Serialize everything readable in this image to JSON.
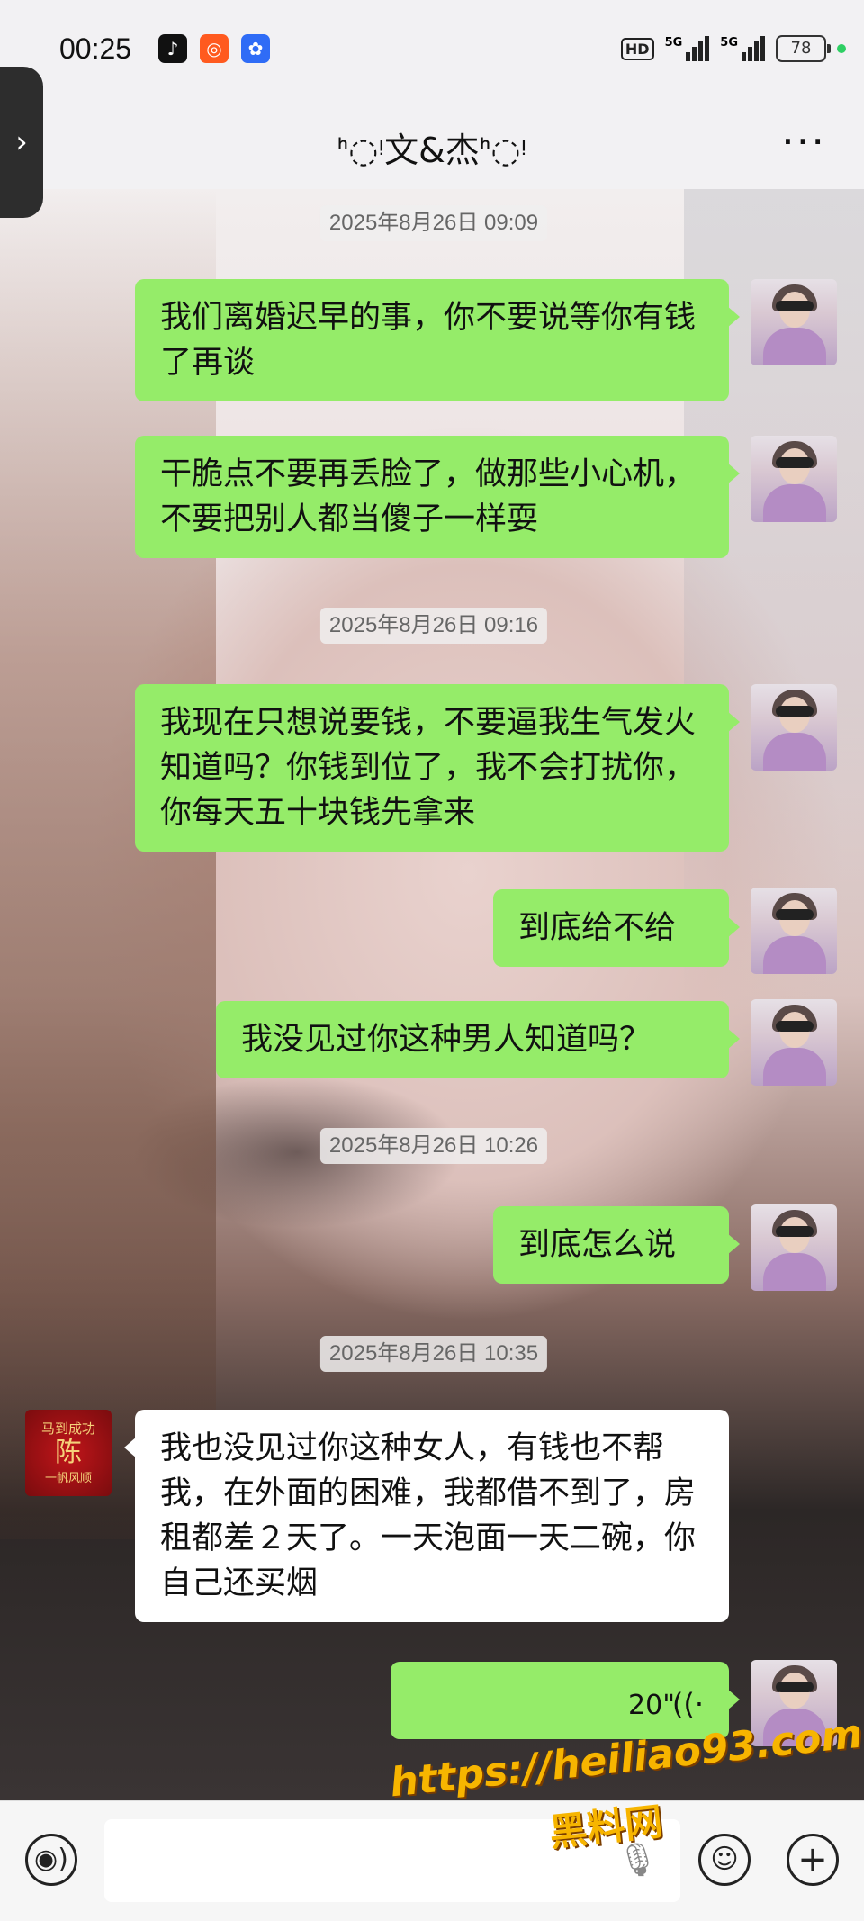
{
  "status_bar": {
    "time": "00:25",
    "apps": [
      {
        "icon": "tiktok-icon",
        "glyph": "♪",
        "color": "#111111"
      },
      {
        "icon": "app-store-icon",
        "glyph": "◎",
        "color": "#ff5a1f"
      },
      {
        "icon": "baidu-paw-icon",
        "glyph": "✿",
        "color": "#2f6cf6"
      }
    ],
    "hd": "HD",
    "signal1": "5G",
    "signal2": "5G",
    "battery": "78"
  },
  "nav": {
    "title": "ᑋ◌ᵎ文&杰ᑋ◌ᵎ",
    "back_glyph": "‹",
    "edge_glyph": "›",
    "more_glyph": "···"
  },
  "messages": {
    "t1": "2025年8月26日 09:09",
    "m1": "我们离婚迟早的事，你不要说等你有钱了再谈",
    "m2": "干脆点不要再丢脸了，做那些小心机，不要把别人都当傻子一样耍",
    "t2": "2025年8月26日 09:16",
    "m3": "我现在只想说要钱，不要逼我生气发火知道吗？你钱到位了，我不会打扰你，你每天五十块钱先拿来",
    "m4": "到底给不给",
    "m5": "我没见过你这种男人知道吗？",
    "t3": "2025年8月26日 10:26",
    "m6": "到底怎么说",
    "t4": "2025年8月26日 10:35",
    "m7": "我也没见过你这种女人，有钱也不帮我，在外面的困难，我都借不到了，房租都差２天了。一天泡面一天二碗，你自己还买烟",
    "m8_duration": "20\"",
    "voice_glyph": "((·"
  },
  "other_avatar": {
    "line1": "马到成功",
    "line2": "陈",
    "line3": "一帆风顺"
  },
  "input_bar": {
    "voice_glyph": "◉)",
    "mic_glyph": "🎙",
    "emoji_glyph": "☺",
    "plus_glyph": "+"
  },
  "watermark": {
    "url": "https://heiliao93.com",
    "name": "黑料网"
  }
}
